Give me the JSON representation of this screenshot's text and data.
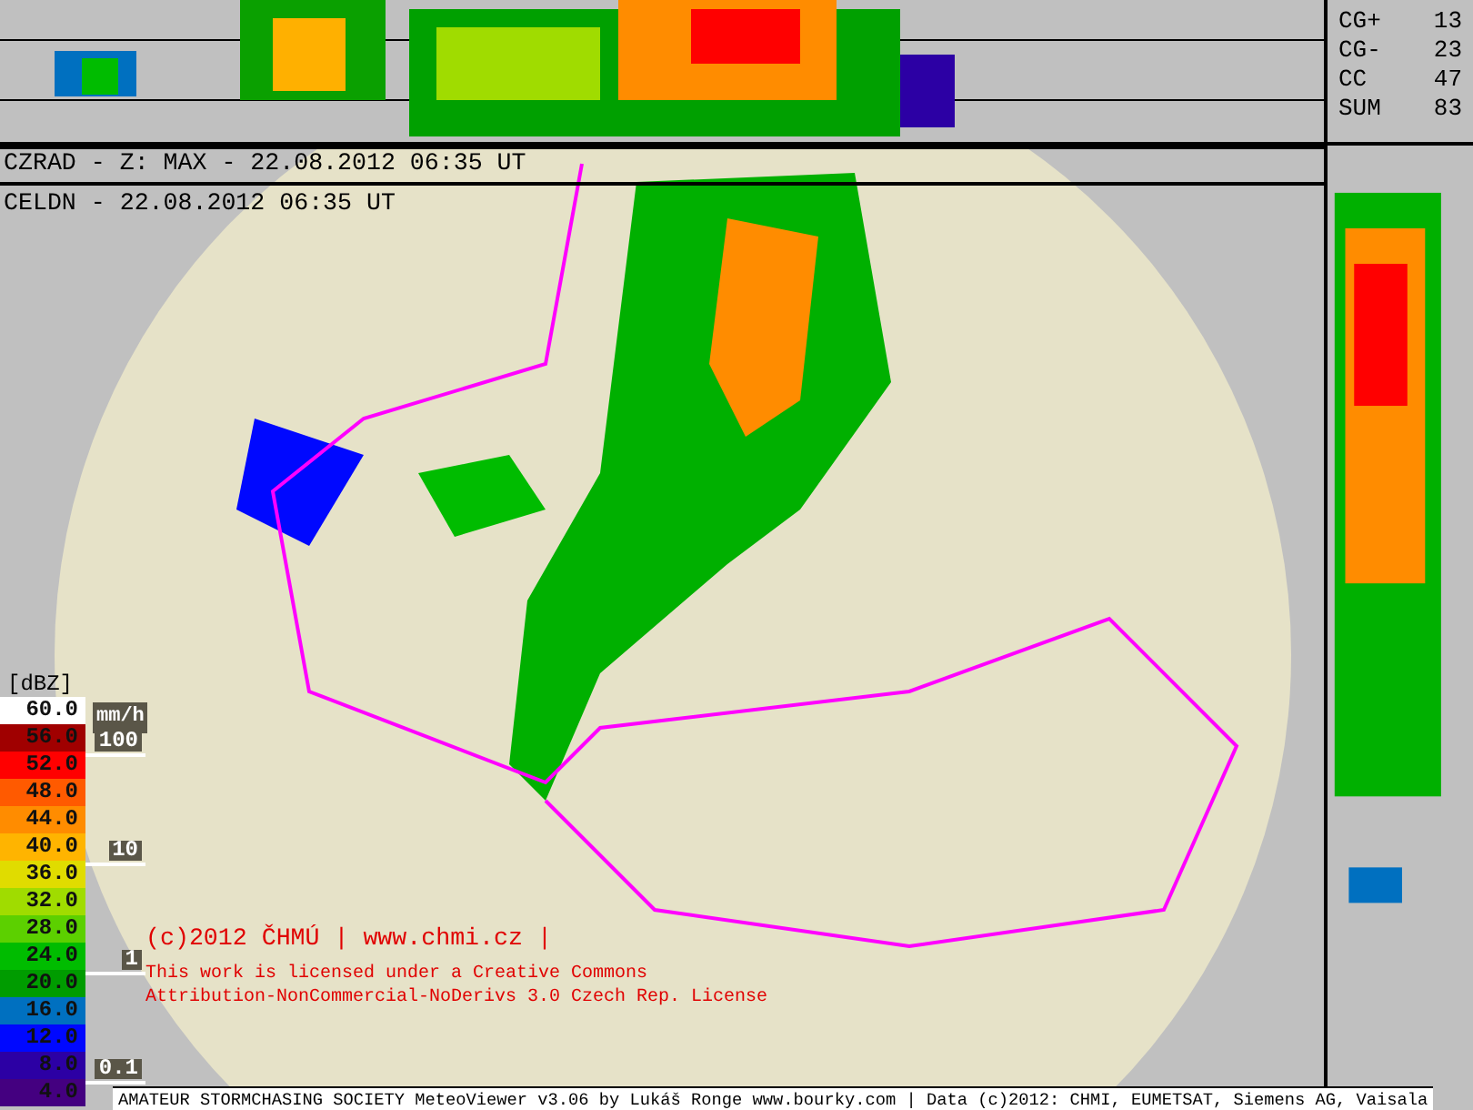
{
  "header_lines": [
    "CZRAD - Z: MAX - 22.08.2012 06:35 UT",
    "CELDN - 22.08.2012 06:35 UT"
  ],
  "lightning_counts": [
    {
      "label": "CG+",
      "value": "13"
    },
    {
      "label": "CG-",
      "value": "23"
    },
    {
      "label": "CC",
      "value": "47"
    },
    {
      "label": "SUM",
      "value": "83"
    }
  ],
  "legend": {
    "unit": "[dBZ]",
    "rate_unit": "mm/h",
    "levels": [
      {
        "label": "60.0",
        "color": "#ffffff"
      },
      {
        "label": "56.0",
        "color": "#a00000"
      },
      {
        "label": "52.0",
        "color": "#ff0000"
      },
      {
        "label": "48.0",
        "color": "#ff5a00"
      },
      {
        "label": "44.0",
        "color": "#ff8c00"
      },
      {
        "label": "40.0",
        "color": "#ffb400"
      },
      {
        "label": "36.0",
        "color": "#e0dc00"
      },
      {
        "label": "32.0",
        "color": "#a0dc00"
      },
      {
        "label": "28.0",
        "color": "#5cd000"
      },
      {
        "label": "24.0",
        "color": "#00bc00"
      },
      {
        "label": "20.0",
        "color": "#009c00"
      },
      {
        "label": "16.0",
        "color": "#0070c0"
      },
      {
        "label": "12.0",
        "color": "#0008ff"
      },
      {
        "label": "8.0",
        "color": "#2c00a4"
      },
      {
        "label": "4.0",
        "color": "#440080"
      }
    ],
    "rate_marks": [
      "100",
      "10",
      "1",
      "0.1"
    ]
  },
  "copyright": "(c)2012 ČHMÚ | www.chmi.cz |",
  "license_lines": [
    "This work is licensed under a Creative Commons",
    "Attribution-NonCommercial-NoDerivs 3.0 Czech Rep. License"
  ],
  "footer": "AMATEUR STORMCHASING SOCIETY MeteoViewer v3.06 by Lukáš Ronge www.bourky.com | Data (c)2012: CHMI, EUMETSAT, Siemens AG, Vaisala"
}
